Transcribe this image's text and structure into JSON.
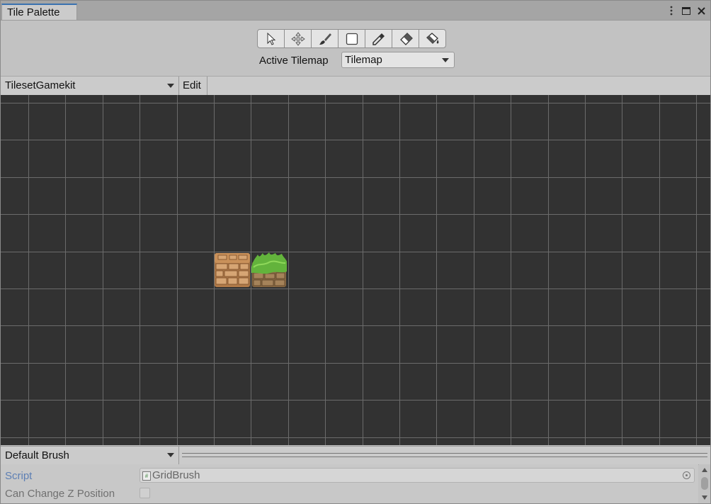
{
  "window": {
    "tab_title": "Tile Palette",
    "menu_icon": "kebab-menu-icon",
    "maximize_icon": "maximize-icon",
    "close_icon": "close-icon"
  },
  "toolbar": {
    "tools": [
      "select-icon",
      "move-icon",
      "paint-brush-icon",
      "box-fill-icon",
      "picker-icon",
      "eraser-icon",
      "flood-fill-icon"
    ],
    "active_tilemap_label": "Active Tilemap",
    "active_tilemap_value": "Tilemap"
  },
  "palette": {
    "selected": "TilesetGamekit",
    "edit_label": "Edit",
    "tiles": [
      "dirt-brick-tile",
      "grass-topped-tile"
    ]
  },
  "brush": {
    "selected": "Default Brush"
  },
  "inspector": {
    "script_label": "Script",
    "script_value": "GridBrush",
    "can_change_z_label": "Can Change Z Position",
    "can_change_z_checked": false
  },
  "colors": {
    "grid_background": "#323232",
    "grid_line": "#6b6b6b",
    "tab_accent": "#3a72b0",
    "script_label": "#5d7fb4"
  }
}
